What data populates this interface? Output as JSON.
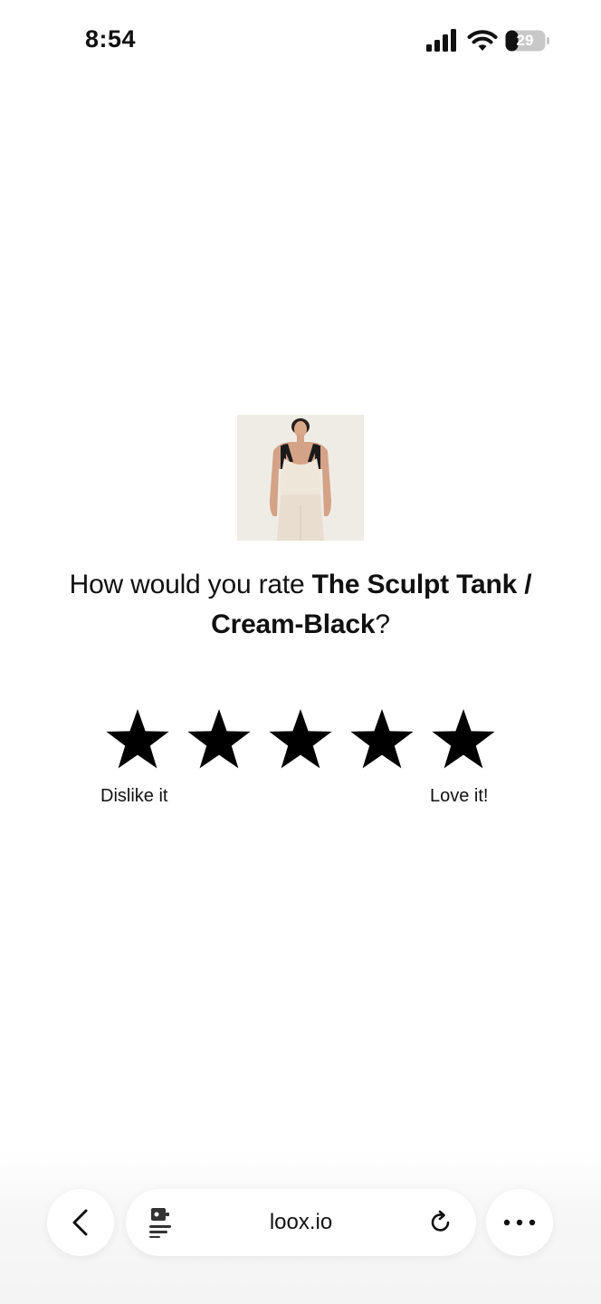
{
  "status_bar": {
    "time": "8:54",
    "battery_level": "29",
    "icons": [
      "signal-icon",
      "wifi-icon",
      "battery-icon"
    ]
  },
  "product": {
    "image_icon": "product-photo",
    "question_prefix": "How would you rate ",
    "name": "The Sculpt Tank / Cream-Black",
    "question_suffix": "?"
  },
  "rating": {
    "stars": 5,
    "star_color": "#000000",
    "low_label": "Dislike it",
    "high_label": "Love it!"
  },
  "browser_bar": {
    "url": "loox.io",
    "icons": [
      "back-chevron-icon",
      "reader-icon",
      "reload-icon",
      "more-icon"
    ]
  }
}
